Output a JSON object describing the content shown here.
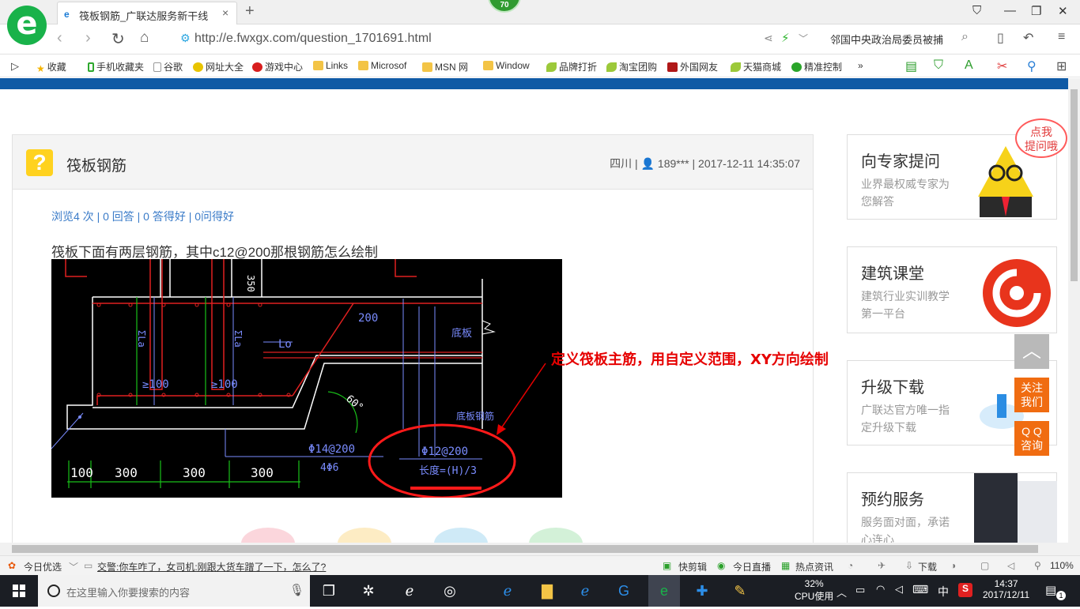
{
  "browser": {
    "tab_title": "筏板钢筋_广联达服务新干线",
    "tab_close": "×",
    "new_tab": "+",
    "badge": "70",
    "url": "http://e.fwxgx.com/question_1701691.html",
    "search_text": "邻国中央政治局委员被捕",
    "window_controls": [
      "⛉",
      "—",
      "❐",
      "✕"
    ]
  },
  "bookmarks": {
    "items": [
      "收藏",
      "手机收藏夹",
      "谷歌",
      "网址大全",
      "游戏中心",
      "Links",
      "Microsof",
      "MSN 网",
      "Window",
      "品牌打折",
      "淘宝团购",
      "外国网友",
      "天猫商城",
      "精准控制"
    ],
    "more": "»"
  },
  "question": {
    "title": "筏板钢筋",
    "meta_region": "四川 |",
    "meta_user": "189***",
    "meta_time": "| 2017-12-11 14:35:07",
    "stats": "浏览4 次 | 0 回答 | 0 答得好 | 0问得好",
    "text": "筏板下面有两层钢筋，其中c12@200那根钢筋怎么绘制",
    "annotation": "定义筏板主筋，用自定义范围，XY方向绘制"
  },
  "cad": {
    "labels": [
      "350",
      "200",
      "Lo",
      "底板",
      "≥100",
      "≥100",
      "60°",
      "底板钢筋",
      "Φ14@200",
      "4Φ6",
      "Φ12@200",
      "长度=(H)/3",
      "100",
      "300",
      "300",
      "300",
      "ΣLa",
      "ΣLa"
    ]
  },
  "sidebar": {
    "cards": [
      {
        "title": "向专家提问",
        "sub": "业界最权威专家为您解答"
      },
      {
        "title": "建筑课堂",
        "sub": "建筑行业实训教学第一平台"
      },
      {
        "title": "升级下载",
        "sub": "广联达官方唯一指定升级下载"
      },
      {
        "title": "预约服务",
        "sub": "服务面对面，承诺心连心"
      }
    ],
    "bubble": "点我\n提问哦",
    "to_top": "︿",
    "follow": "关注我们",
    "qq": "Q Q 咨询"
  },
  "statusbar": {
    "left": "今日优选",
    "news": "交警:你车咋了，女司机:刚跟大货车蹭了一下，怎么了?",
    "items": [
      "快剪辑",
      "今日直播",
      "热点资讯",
      "下载"
    ],
    "zoom": "110%"
  },
  "taskbar": {
    "search_placeholder": "在这里输入你要搜索的内容",
    "cpu_percent": "32%",
    "cpu_label": "CPU使用",
    "ime": "中",
    "time": "14:37",
    "date": "2017/12/11",
    "notif_count": "1"
  },
  "colors": {
    "brand_blue": "#0f5aa5",
    "browser_green": "#19b24a",
    "annotation_red": "#e60000",
    "orange": "#f06c11"
  }
}
